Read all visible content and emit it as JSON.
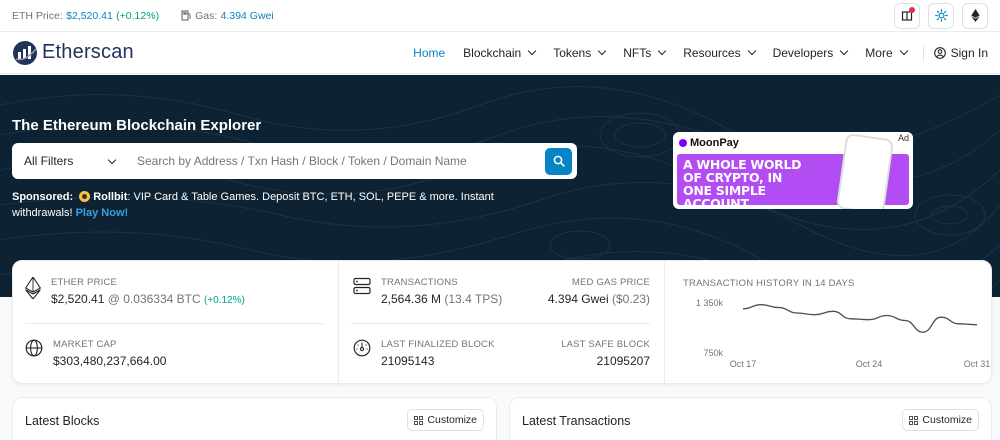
{
  "topbar": {
    "eth_price_label": "ETH Price:",
    "eth_price_value": "$2,520.41",
    "eth_price_change": "(+0.12%)",
    "gas_label": "Gas:",
    "gas_value": "4.394 Gwei"
  },
  "nav": {
    "logo_text": "Etherscan",
    "items": [
      {
        "label": "Home"
      },
      {
        "label": "Blockchain"
      },
      {
        "label": "Tokens"
      },
      {
        "label": "NFTs"
      },
      {
        "label": "Resources"
      },
      {
        "label": "Developers"
      },
      {
        "label": "More"
      }
    ],
    "signin": "Sign In"
  },
  "hero": {
    "title": "The Ethereum Blockchain Explorer",
    "filter_label": "All Filters",
    "search_placeholder": "Search by Address / Txn Hash / Block / Token / Domain Name",
    "sponsored_label": "Sponsored:",
    "sponsor_name": "Rollbit",
    "sponsor_text": ": VIP Card & Table Games. Deposit BTC, ETH, SOL, PEPE & more. Instant withdrawals!",
    "sponsor_cta": "Play Now!",
    "ad": {
      "label": "Ad",
      "brand": "MoonPay",
      "headline": "A WHOLE WORLD OF CRYPTO, IN ONE SIMPLE ACCOUNT"
    }
  },
  "stats": {
    "ether_price": {
      "label": "ETHER PRICE",
      "value": "$2,520.41",
      "btc": "@ 0.036334 BTC",
      "change": "(+0.12%)"
    },
    "market_cap": {
      "label": "MARKET CAP",
      "value": "$303,480,237,664.00"
    },
    "transactions": {
      "label": "TRANSACTIONS",
      "value": "2,564.36 M",
      "tps": "(13.4 TPS)"
    },
    "med_gas": {
      "label": "MED GAS PRICE",
      "value": "4.394 Gwei",
      "usd": "($0.23)"
    },
    "last_finalized": {
      "label": "LAST FINALIZED BLOCK",
      "value": "21095143"
    },
    "last_safe": {
      "label": "LAST SAFE BLOCK",
      "value": "21095207"
    }
  },
  "chart_data": {
    "type": "line",
    "title": "TRANSACTION HISTORY IN 14 DAYS",
    "x_ticks": [
      "Oct 17",
      "Oct 24",
      "Oct 31"
    ],
    "y_ticks": [
      "1 350k",
      "750k"
    ],
    "ylim": [
      750000,
      1350000
    ],
    "series": [
      {
        "values": [
          1280000,
          1330000,
          1295000,
          1230000,
          1210000,
          1250000,
          1160000,
          1150000,
          1200000,
          1140000,
          1000000,
          1180000,
          1100000,
          1090000
        ]
      }
    ],
    "color": "#495057",
    "grid": false
  },
  "latest_blocks": {
    "title": "Latest Blocks",
    "customize": "Customize"
  },
  "latest_txns": {
    "title": "Latest Transactions",
    "customize": "Customize"
  },
  "colors": {
    "accent": "#0784c3",
    "hero_bg": "#0d2232",
    "positive": "#00a186"
  }
}
